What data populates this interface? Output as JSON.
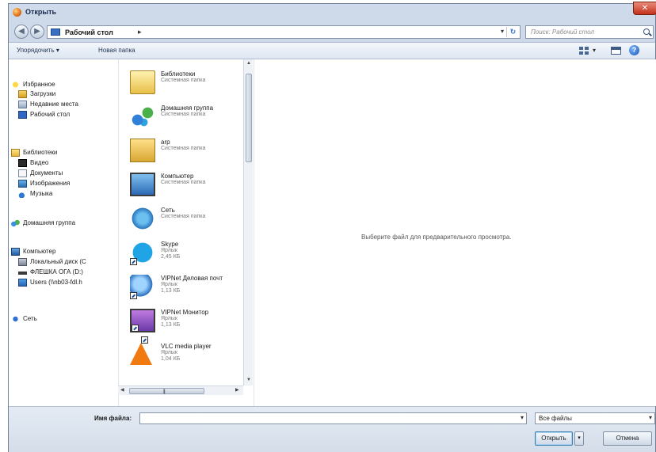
{
  "window": {
    "title": "Открыть",
    "close_label": "✕"
  },
  "address": {
    "location": "Рабочий стол",
    "separator": "▸",
    "search_placeholder": "Поиск: Рабочий стол"
  },
  "toolbar": {
    "organize_label": "Упорядочить ▾",
    "newfolder_label": "Новая папка",
    "help_label": "?"
  },
  "sidebar": {
    "favorites": [
      {
        "label": "Избранное",
        "icon": "star-icon"
      },
      {
        "label": "Загрузки",
        "icon": "downloads-icon"
      },
      {
        "label": "Недавние места",
        "icon": "recent-places-icon"
      },
      {
        "label": "Рабочий стол",
        "icon": "desktop-icon"
      }
    ],
    "libraries": [
      {
        "label": "Библиотеки",
        "icon": "libraries-icon"
      },
      {
        "label": "Видео",
        "icon": "video-icon"
      },
      {
        "label": "Документы",
        "icon": "documents-icon"
      },
      {
        "label": "Изображения",
        "icon": "pictures-icon"
      },
      {
        "label": "Музыка",
        "icon": "music-icon"
      }
    ],
    "homegroup": {
      "label": "Домашняя группа",
      "icon": "homegroup-icon"
    },
    "computer": [
      {
        "label": "Компьютер",
        "icon": "computer-icon"
      },
      {
        "label": "Локальный диск (C",
        "icon": "disk-icon"
      },
      {
        "label": "ФЛЕШКА ОГА (D:)",
        "icon": "usb-drive-icon"
      },
      {
        "label": "Users (\\\\nb03-fdl.h",
        "icon": "network-drive-icon"
      }
    ],
    "network": {
      "label": "Сеть",
      "icon": "network-icon"
    }
  },
  "files": [
    {
      "name": "Библиотеки",
      "line2": "Системная папка",
      "line3": "",
      "icon": "libraries-folder-icon",
      "shortcut": false
    },
    {
      "name": "Домашняя группа",
      "line2": "Системная папка",
      "line3": "",
      "icon": "homegroup-icon",
      "shortcut": false
    },
    {
      "name": "arp",
      "line2": "Системная папка",
      "line3": "",
      "icon": "user-folder-icon",
      "shortcut": false
    },
    {
      "name": "Компьютер",
      "line2": "Системная папка",
      "line3": "",
      "icon": "computer-icon",
      "shortcut": false
    },
    {
      "name": "Сеть",
      "line2": "Системная папка",
      "line3": "",
      "icon": "network-globe-icon",
      "shortcut": false
    },
    {
      "name": "Skype",
      "line2": "Ярлык",
      "line3": "2,45 КБ",
      "icon": "skype-icon",
      "shortcut": true
    },
    {
      "name": "VIPNet Деловая почт",
      "line2": "Ярлык",
      "line3": "1,13 КБ",
      "icon": "vipnet-mail-icon",
      "shortcut": true
    },
    {
      "name": "VIPNet Монитор",
      "line2": "Ярлык",
      "line3": "1,13 КБ",
      "icon": "vipnet-monitor-icon",
      "shortcut": true
    },
    {
      "name": "VLC media player",
      "line2": "Ярлык",
      "line3": "1,04 КБ",
      "icon": "vlc-icon",
      "shortcut": true
    }
  ],
  "preview": {
    "message": "Выберите файл для предварительного просмотра."
  },
  "bottom": {
    "filename_label": "Имя файла:",
    "filename_value": "",
    "filetype_value": "Все файлы",
    "open_label": "Открыть",
    "open_split_label": "▾",
    "cancel_label": "Отмена"
  }
}
